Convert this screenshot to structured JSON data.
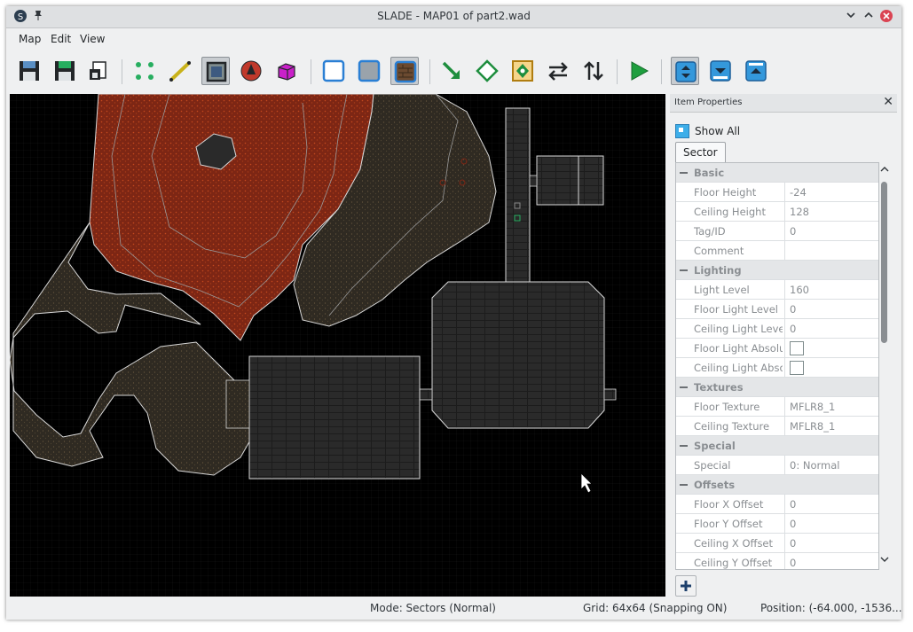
{
  "window": {
    "title": "SLADE - MAP01 of part2.wad"
  },
  "menu": {
    "items": [
      "Map",
      "Edit",
      "View"
    ]
  },
  "icons": {
    "app": "slade-logo-icon",
    "pin": "pin-icon",
    "minimize": "chevron-down-icon",
    "maximize": "chevron-up-icon",
    "close": "close-icon"
  },
  "toolbar": {
    "tools": [
      {
        "name": "save-map-icon"
      },
      {
        "name": "save-map-as-icon"
      },
      {
        "name": "rename-map-icon"
      },
      {
        "name": "vertices-mode-icon"
      },
      {
        "name": "lines-mode-icon"
      },
      {
        "name": "sectors-mode-icon",
        "active": true
      },
      {
        "name": "things-mode-icon"
      },
      {
        "name": "3d-mode-icon"
      },
      {
        "name": "sector-flat-normal-icon"
      },
      {
        "name": "sector-flat-floor-icon"
      },
      {
        "name": "sector-flat-textured-icon",
        "active": true
      },
      {
        "name": "draw-lines-icon"
      },
      {
        "name": "edit-objects-icon"
      },
      {
        "name": "merge-icon"
      },
      {
        "name": "flip-horizontal-icon"
      },
      {
        "name": "flip-vertical-icon"
      },
      {
        "name": "run-map-icon"
      },
      {
        "name": "sector-both-icon",
        "active": true
      },
      {
        "name": "sector-floor-icon"
      },
      {
        "name": "sector-ceiling-icon"
      }
    ]
  },
  "panel": {
    "title": "Item Properties",
    "show_all": "Show All",
    "tab": "Sector",
    "rows": [
      {
        "group": "Basic"
      },
      {
        "key": "Floor Height",
        "value": "-24"
      },
      {
        "key": "Ceiling Height",
        "value": "128"
      },
      {
        "key": "Tag/ID",
        "value": "0"
      },
      {
        "key": "Comment",
        "value": ""
      },
      {
        "group": "Lighting"
      },
      {
        "key": "Light Level",
        "value": "160"
      },
      {
        "key": "Floor Light Level",
        "value": "0"
      },
      {
        "key": "Ceiling Light Level",
        "value": "0"
      },
      {
        "key": "Floor Light Absolute",
        "check": true
      },
      {
        "key": "Ceiling Light Absolute",
        "check": true
      },
      {
        "group": "Textures"
      },
      {
        "key": "Floor Texture",
        "value": "MFLR8_1"
      },
      {
        "key": "Ceiling Texture",
        "value": "MFLR8_1"
      },
      {
        "group": "Special"
      },
      {
        "key": "Special",
        "value": "0: Normal"
      },
      {
        "group": "Offsets"
      },
      {
        "key": "Floor X Offset",
        "value": "0"
      },
      {
        "key": "Floor Y Offset",
        "value": "0"
      },
      {
        "key": "Ceiling X Offset",
        "value": "0"
      },
      {
        "key": "Ceiling Y Offset",
        "value": "0"
      }
    ]
  },
  "status": {
    "mode": "Mode: Sectors (Normal)",
    "grid": "Grid: 64x64 (Snapping ON)",
    "position": "Position: (-64.000, -1536..."
  },
  "colors": {
    "lava": "#8a2a14",
    "rock": "#3a3329",
    "tile": "#2b2b2b",
    "line": "#d8d8d8"
  }
}
